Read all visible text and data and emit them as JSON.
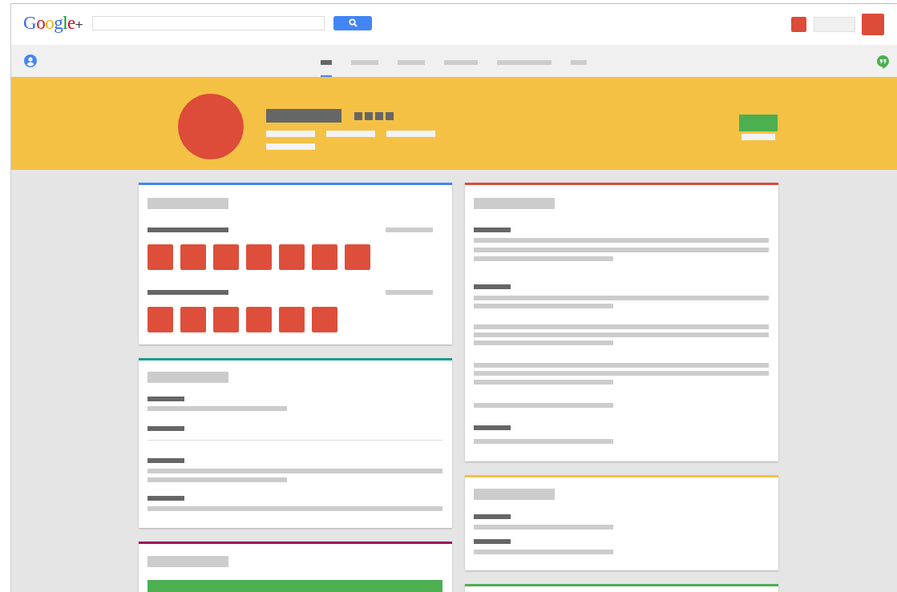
{
  "header": {
    "logo": "Google+"
  },
  "tabs": [
    {
      "selected": true
    },
    {
      "selected": false
    },
    {
      "selected": false
    },
    {
      "selected": false
    },
    {
      "selected": false
    },
    {
      "selected": false
    }
  ],
  "columns": [
    {
      "cards": [
        {
          "kind": "photos",
          "color": "#4285f4"
        },
        {
          "kind": "details",
          "color": "#1a9d8f"
        },
        {
          "kind": "action",
          "color": "#a0105c"
        }
      ]
    },
    {
      "cards": [
        {
          "kind": "about",
          "color": "#dd4b39"
        },
        {
          "kind": "contact",
          "color": "#f4c145"
        },
        {
          "kind": "empty",
          "color": "#4caf50"
        }
      ]
    }
  ]
}
